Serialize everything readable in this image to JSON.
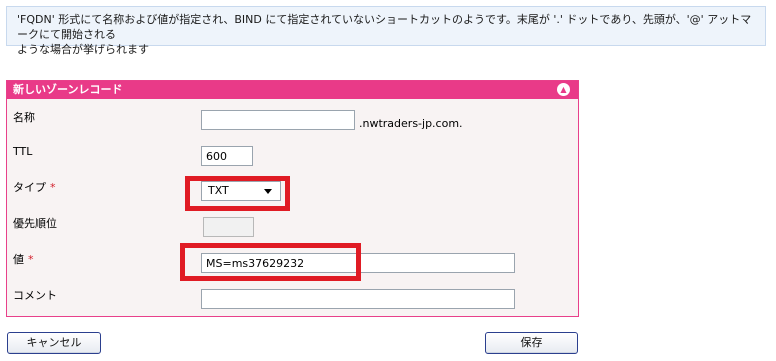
{
  "info": {
    "line1": "'FQDN' 形式にて名称および値が指定され、BIND にて指定されていないショートカットのようです。末尾が '.' ドットであり、先頭が、'@' アットマークにて開始される",
    "line2": "ような場合が挙げられます"
  },
  "panel": {
    "title": "新しいゾーンレコード",
    "collapse_icon": "chevron-up-icon"
  },
  "form": {
    "name": {
      "label": "名称",
      "value": "",
      "suffix": ".nwtraders-jp.com."
    },
    "ttl": {
      "label": "TTL",
      "value": "600"
    },
    "type": {
      "label": "タイプ",
      "required_mark": "*",
      "value": "TXT"
    },
    "priority": {
      "label": "優先順位",
      "value": ""
    },
    "value": {
      "label": "値",
      "required_mark": "*",
      "value": "MS=ms37629232"
    },
    "comment": {
      "label": "コメント",
      "value": ""
    }
  },
  "buttons": {
    "cancel": "キャンセル",
    "save": "保存"
  },
  "colors": {
    "accent": "#e93a88",
    "highlight": "#e01b24",
    "info_bg": "#eef4fb"
  }
}
